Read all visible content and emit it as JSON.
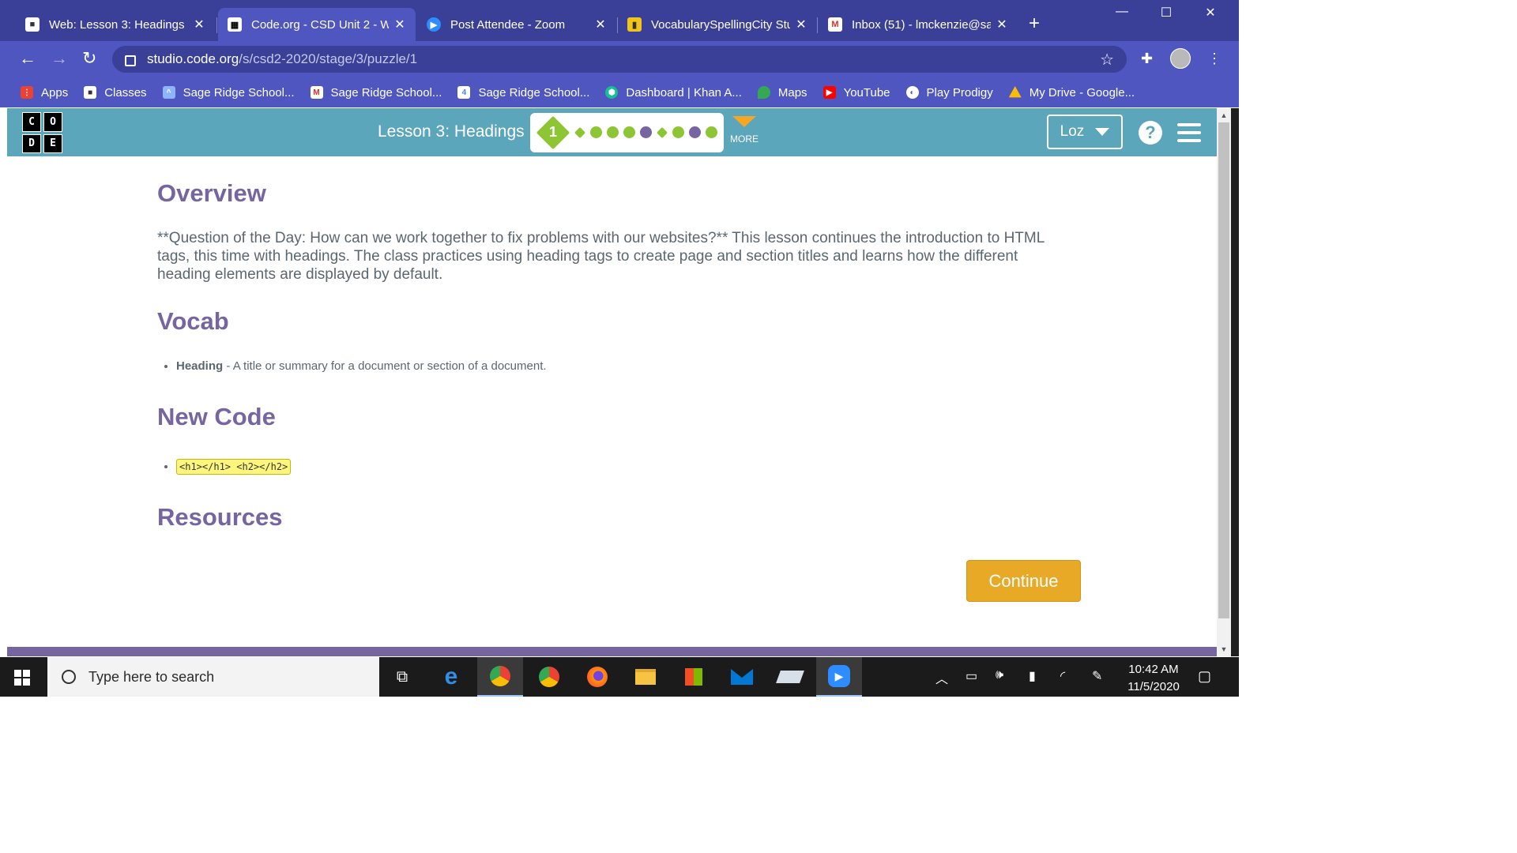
{
  "browser": {
    "tabs": [
      {
        "title": "Web: Lesson 3: Headings",
        "active": false,
        "icon": "classroom-icon"
      },
      {
        "title": "Code.org - CSD Unit 2 - W",
        "active": true,
        "icon": "codeorg-icon"
      },
      {
        "title": "Post Attendee - Zoom",
        "active": false,
        "icon": "zoom-icon"
      },
      {
        "title": "VocabularySpellingCity Stu",
        "active": false,
        "icon": "spellingcity-icon"
      },
      {
        "title": "Inbox (51) - lmckenzie@sa",
        "active": false,
        "icon": "gmail-icon"
      }
    ],
    "new_tab": "+",
    "url_host": "studio.code.org",
    "url_path": "/s/csd2-2020/stage/3/puzzle/1",
    "bookmarks": [
      {
        "label": "Apps",
        "icon": "apps-grid-icon",
        "color": "#ea4335"
      },
      {
        "label": "Classes",
        "icon": "classroom-icon",
        "color": "#444444"
      },
      {
        "label": "Sage Ridge School...",
        "icon": "graduation-cap-icon",
        "color": "#4285f4"
      },
      {
        "label": "Sage Ridge School...",
        "icon": "gmail-icon",
        "color": "#d93025"
      },
      {
        "label": "Sage Ridge School...",
        "icon": "calendar-icon",
        "color": "#4285f4"
      },
      {
        "label": "Dashboard | Khan A...",
        "icon": "khan-academy-icon",
        "color": "#14bf96"
      },
      {
        "label": "Maps",
        "icon": "maps-pin-icon",
        "color": "#34a853"
      },
      {
        "label": "YouTube",
        "icon": "youtube-icon",
        "color": "#ff0000"
      },
      {
        "label": "Play Prodigy",
        "icon": "prodigy-icon",
        "color": "#ffffff"
      },
      {
        "label": "My Drive - Google...",
        "icon": "google-drive-icon",
        "color": "#fbbc04"
      }
    ]
  },
  "header": {
    "logo_letters": [
      "C",
      "O",
      "D",
      "E"
    ],
    "lesson_title": "Lesson 3: Headings",
    "current_level": "1",
    "more_label": "MORE",
    "user_label": "Loz",
    "help_label": "?",
    "progress_colors": {
      "green": "#8ec534",
      "purple": "#7665a0"
    }
  },
  "content": {
    "overview_heading": "Overview",
    "overview_text": "**Question of the Day: How can we work together to fix problems with our websites?** This lesson continues the introduction to HTML tags, this time with headings. The class practices using heading tags to create page and section titles and learns how the different heading elements are displayed by default.",
    "vocab_heading": "Vocab",
    "vocab_term": "Heading",
    "vocab_def": " - A title or summary for a document or section of a document.",
    "newcode_heading": "New Code",
    "newcode_item": "<h1></h1> <h2></h2>",
    "resources_heading": "Resources",
    "continue_label": "Continue"
  },
  "taskbar": {
    "search_placeholder": "Type here to search",
    "time": "10:42 AM",
    "date": "11/5/2020"
  }
}
